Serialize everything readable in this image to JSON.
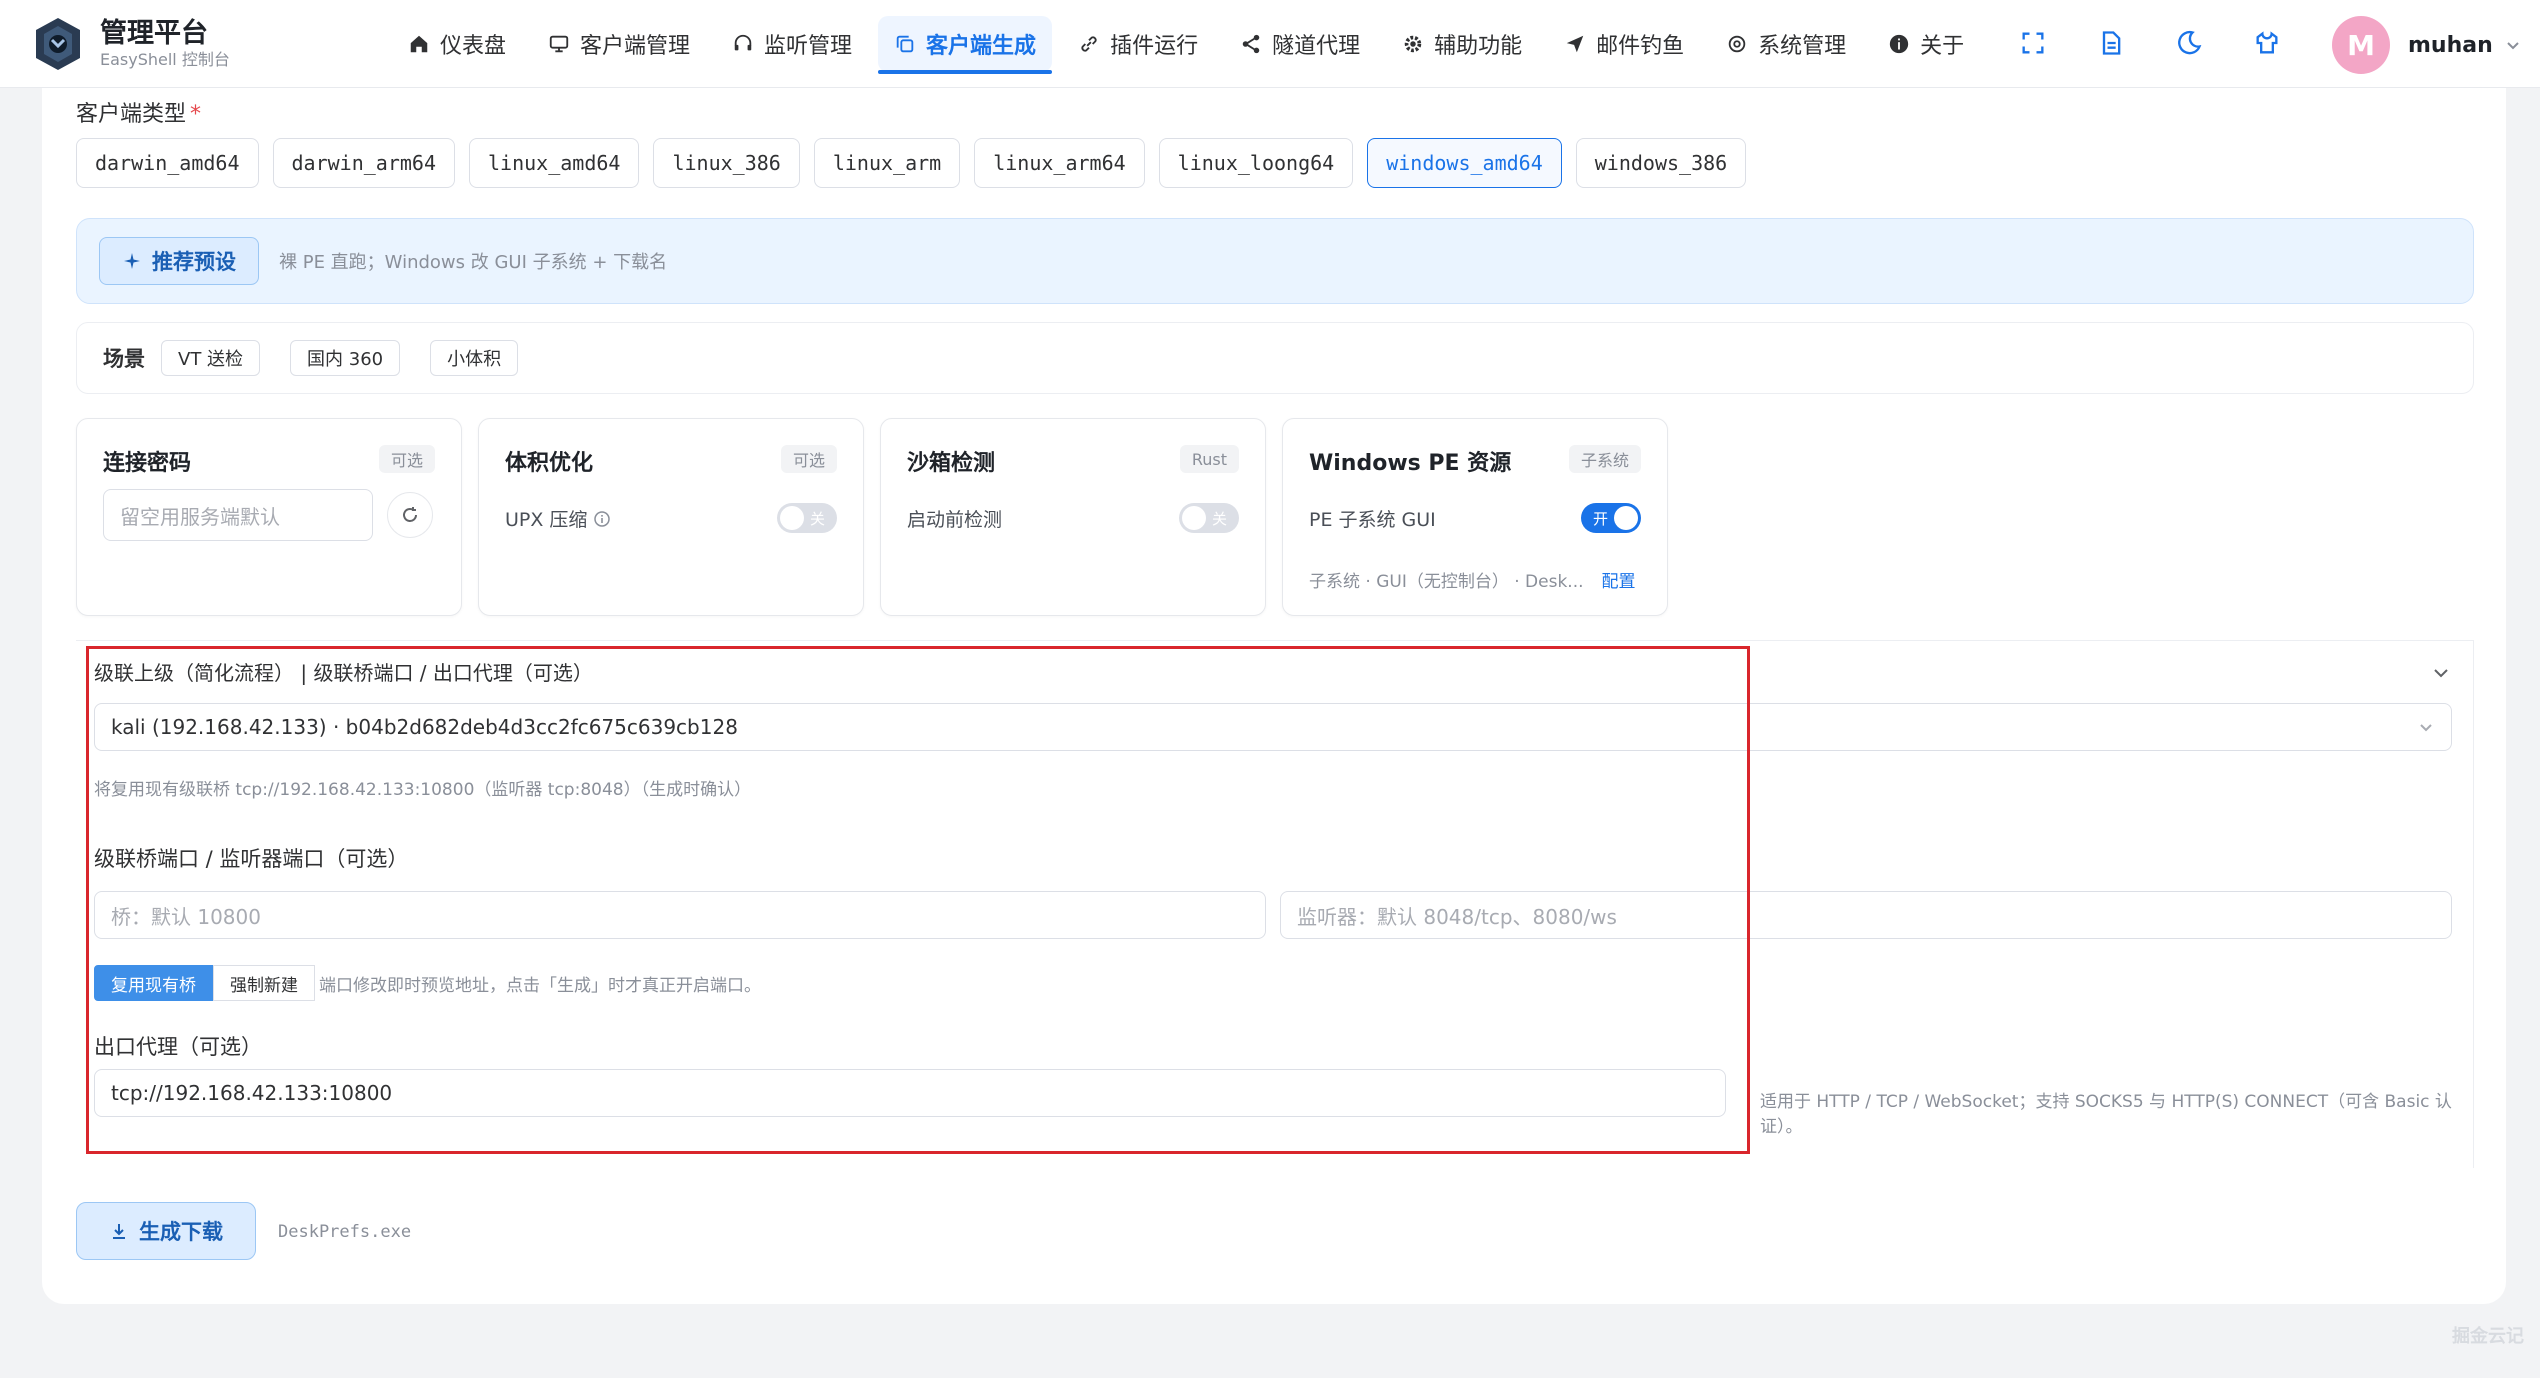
{
  "brand": {
    "title": "管理平台",
    "subtitle": "EasyShell 控制台"
  },
  "nav": [
    {
      "label": "仪表盘",
      "icon": "home-icon"
    },
    {
      "label": "客户端管理",
      "icon": "monitor-icon"
    },
    {
      "label": "监听管理",
      "icon": "headset-icon"
    },
    {
      "label": "客户端生成",
      "icon": "copy-icon",
      "active": true
    },
    {
      "label": "插件运行",
      "icon": "link-icon"
    },
    {
      "label": "隧道代理",
      "icon": "share-icon"
    },
    {
      "label": "辅助功能",
      "icon": "gear-icon"
    },
    {
      "label": "邮件钓鱼",
      "icon": "send-icon"
    },
    {
      "label": "系统管理",
      "icon": "settings-icon"
    },
    {
      "label": "关于",
      "icon": "info-icon"
    }
  ],
  "user": {
    "avatar": "M",
    "name": "muhan"
  },
  "client_type": {
    "label": "客户端类型",
    "required": "*",
    "options": [
      "darwin_amd64",
      "darwin_arm64",
      "linux_amd64",
      "linux_386",
      "linux_arm",
      "linux_arm64",
      "linux_loong64",
      "windows_amd64",
      "windows_386"
    ],
    "selected": "windows_amd64"
  },
  "preset": {
    "button": "推荐预设",
    "desc": "裸 PE 直跑；Windows 改 GUI 子系统 + 下载名"
  },
  "scene": {
    "label": "场景",
    "options": [
      "VT 送检",
      "国内 360",
      "小体积"
    ]
  },
  "cards": {
    "password": {
      "title": "连接密码",
      "tag": "可选",
      "placeholder": "留空用服务端默认"
    },
    "size": {
      "title": "体积优化",
      "tag": "可选",
      "option": "UPX 压缩",
      "switch": "关"
    },
    "sandbox": {
      "title": "沙箱检测",
      "tag": "Rust",
      "option": "启动前检测",
      "switch": "关"
    },
    "pe": {
      "title": "Windows PE 资源",
      "tag": "子系统",
      "option": "PE 子系统 GUI",
      "switch": "开",
      "sub": "子系统 · GUI（无控制台） · Desk...",
      "link": "配置"
    }
  },
  "advanced": {
    "title": "级联上级（简化流程） | 级联桥端口 / 出口代理（可选）",
    "selected_parent": "kali (192.168.42.133) · b04b2d682deb4d3cc2fc675c639cb128",
    "reuse_hint": "将复用现有级联桥 tcp://192.168.42.133:10800（监听器 tcp:8048）（生成时确认）",
    "port_label": "级联桥端口 / 监听器端口（可选）",
    "bridge_placeholder": "桥：默认 10800",
    "listener_placeholder": "监听器：默认 8048/tcp、8080/ws",
    "seg_reuse": "复用现有桥",
    "seg_new": "强制新建",
    "seg_hint": "端口修改即时预览地址，点击「生成」时才真正开启端口。",
    "proxy_label": "出口代理（可选）",
    "proxy_value": "tcp://192.168.42.133:10800",
    "proxy_hint": "适用于 HTTP / TCP / WebSocket；支持 SOCKS5 与 HTTP(S) CONNECT（可含 Basic 认证）。"
  },
  "generate": {
    "button": "生成下载",
    "filename": "DeskPrefs.exe"
  },
  "watermark": "掘金云记",
  "colors": {
    "accent": "#1a73e8",
    "highlight": "#d9262c",
    "avatar": "#f3a6c6"
  }
}
